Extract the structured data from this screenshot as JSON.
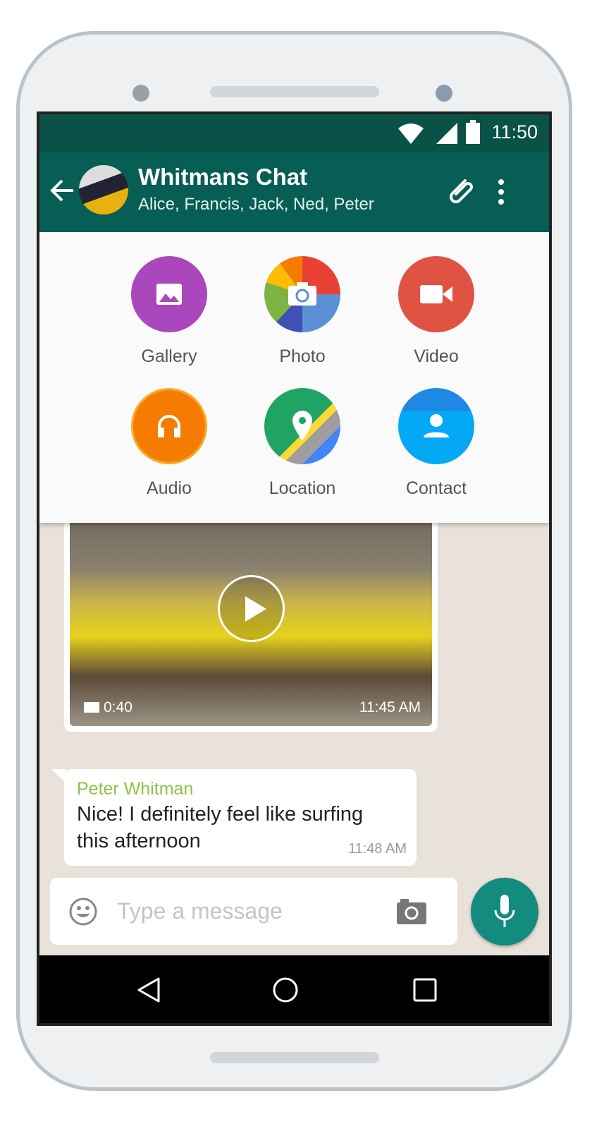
{
  "status": {
    "time": "11:50"
  },
  "header": {
    "title": "Whitmans Chat",
    "subtitle": "Alice, Francis, Jack, Ned, Peter"
  },
  "attach": [
    {
      "label": "Gallery",
      "icon": "gallery-icon",
      "color": "#ab47bc"
    },
    {
      "label": "Photo",
      "icon": "camera-icon",
      "color": "#5c9bd5"
    },
    {
      "label": "Video",
      "icon": "video-camera-icon",
      "color": "#e05241"
    },
    {
      "label": "Audio",
      "icon": "headphones-icon",
      "color": "#f59a1a"
    },
    {
      "label": "Location",
      "icon": "map-pin-icon",
      "color": "#1fa463"
    },
    {
      "label": "Contact",
      "icon": "person-icon",
      "color": "#1ba1e2"
    }
  ],
  "video_message": {
    "duration": "0:40",
    "time": "11:45 AM"
  },
  "message": {
    "sender": "Peter Whitman",
    "text": "Nice! I definitely feel like surfing this afternoon",
    "time": "11:48 AM"
  },
  "composer": {
    "placeholder": "Type a message"
  }
}
